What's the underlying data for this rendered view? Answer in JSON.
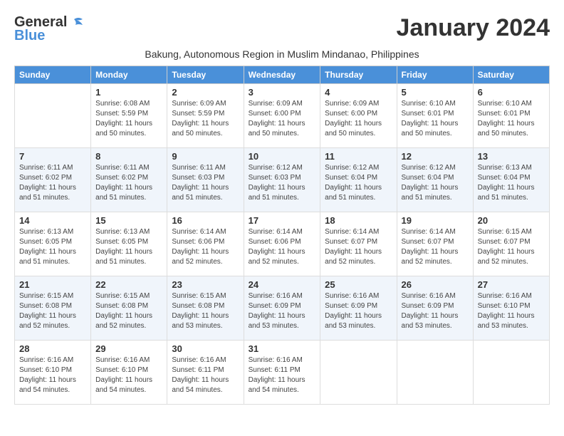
{
  "logo": {
    "general": "General",
    "blue": "Blue"
  },
  "title": "January 2024",
  "subtitle": "Bakung, Autonomous Region in Muslim Mindanao, Philippines",
  "days_of_week": [
    "Sunday",
    "Monday",
    "Tuesday",
    "Wednesday",
    "Thursday",
    "Friday",
    "Saturday"
  ],
  "weeks": [
    [
      {
        "day": "",
        "info": ""
      },
      {
        "day": "1",
        "sunrise": "6:08 AM",
        "sunset": "5:59 PM",
        "daylight": "11 hours and 50 minutes."
      },
      {
        "day": "2",
        "sunrise": "6:09 AM",
        "sunset": "5:59 PM",
        "daylight": "11 hours and 50 minutes."
      },
      {
        "day": "3",
        "sunrise": "6:09 AM",
        "sunset": "6:00 PM",
        "daylight": "11 hours and 50 minutes."
      },
      {
        "day": "4",
        "sunrise": "6:09 AM",
        "sunset": "6:00 PM",
        "daylight": "11 hours and 50 minutes."
      },
      {
        "day": "5",
        "sunrise": "6:10 AM",
        "sunset": "6:01 PM",
        "daylight": "11 hours and 50 minutes."
      },
      {
        "day": "6",
        "sunrise": "6:10 AM",
        "sunset": "6:01 PM",
        "daylight": "11 hours and 50 minutes."
      }
    ],
    [
      {
        "day": "7",
        "sunrise": "6:11 AM",
        "sunset": "6:02 PM",
        "daylight": "11 hours and 51 minutes."
      },
      {
        "day": "8",
        "sunrise": "6:11 AM",
        "sunset": "6:02 PM",
        "daylight": "11 hours and 51 minutes."
      },
      {
        "day": "9",
        "sunrise": "6:11 AM",
        "sunset": "6:03 PM",
        "daylight": "11 hours and 51 minutes."
      },
      {
        "day": "10",
        "sunrise": "6:12 AM",
        "sunset": "6:03 PM",
        "daylight": "11 hours and 51 minutes."
      },
      {
        "day": "11",
        "sunrise": "6:12 AM",
        "sunset": "6:04 PM",
        "daylight": "11 hours and 51 minutes."
      },
      {
        "day": "12",
        "sunrise": "6:12 AM",
        "sunset": "6:04 PM",
        "daylight": "11 hours and 51 minutes."
      },
      {
        "day": "13",
        "sunrise": "6:13 AM",
        "sunset": "6:04 PM",
        "daylight": "11 hours and 51 minutes."
      }
    ],
    [
      {
        "day": "14",
        "sunrise": "6:13 AM",
        "sunset": "6:05 PM",
        "daylight": "11 hours and 51 minutes."
      },
      {
        "day": "15",
        "sunrise": "6:13 AM",
        "sunset": "6:05 PM",
        "daylight": "11 hours and 51 minutes."
      },
      {
        "day": "16",
        "sunrise": "6:14 AM",
        "sunset": "6:06 PM",
        "daylight": "11 hours and 52 minutes."
      },
      {
        "day": "17",
        "sunrise": "6:14 AM",
        "sunset": "6:06 PM",
        "daylight": "11 hours and 52 minutes."
      },
      {
        "day": "18",
        "sunrise": "6:14 AM",
        "sunset": "6:07 PM",
        "daylight": "11 hours and 52 minutes."
      },
      {
        "day": "19",
        "sunrise": "6:14 AM",
        "sunset": "6:07 PM",
        "daylight": "11 hours and 52 minutes."
      },
      {
        "day": "20",
        "sunrise": "6:15 AM",
        "sunset": "6:07 PM",
        "daylight": "11 hours and 52 minutes."
      }
    ],
    [
      {
        "day": "21",
        "sunrise": "6:15 AM",
        "sunset": "6:08 PM",
        "daylight": "11 hours and 52 minutes."
      },
      {
        "day": "22",
        "sunrise": "6:15 AM",
        "sunset": "6:08 PM",
        "daylight": "11 hours and 52 minutes."
      },
      {
        "day": "23",
        "sunrise": "6:15 AM",
        "sunset": "6:08 PM",
        "daylight": "11 hours and 53 minutes."
      },
      {
        "day": "24",
        "sunrise": "6:16 AM",
        "sunset": "6:09 PM",
        "daylight": "11 hours and 53 minutes."
      },
      {
        "day": "25",
        "sunrise": "6:16 AM",
        "sunset": "6:09 PM",
        "daylight": "11 hours and 53 minutes."
      },
      {
        "day": "26",
        "sunrise": "6:16 AM",
        "sunset": "6:09 PM",
        "daylight": "11 hours and 53 minutes."
      },
      {
        "day": "27",
        "sunrise": "6:16 AM",
        "sunset": "6:10 PM",
        "daylight": "11 hours and 53 minutes."
      }
    ],
    [
      {
        "day": "28",
        "sunrise": "6:16 AM",
        "sunset": "6:10 PM",
        "daylight": "11 hours and 54 minutes."
      },
      {
        "day": "29",
        "sunrise": "6:16 AM",
        "sunset": "6:10 PM",
        "daylight": "11 hours and 54 minutes."
      },
      {
        "day": "30",
        "sunrise": "6:16 AM",
        "sunset": "6:11 PM",
        "daylight": "11 hours and 54 minutes."
      },
      {
        "day": "31",
        "sunrise": "6:16 AM",
        "sunset": "6:11 PM",
        "daylight": "11 hours and 54 minutes."
      },
      {
        "day": "",
        "info": ""
      },
      {
        "day": "",
        "info": ""
      },
      {
        "day": "",
        "info": ""
      }
    ]
  ]
}
